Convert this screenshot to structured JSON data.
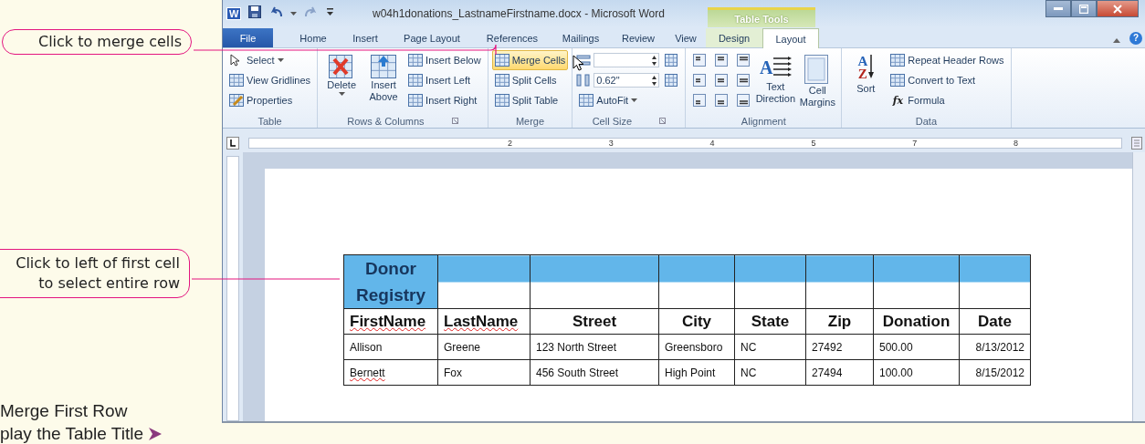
{
  "callouts": [
    {
      "text": "Click to merge cells"
    },
    {
      "text": "Click to left of first cell to select entire row"
    }
  ],
  "caption": {
    "line_1": "Merge First Row",
    "line_2": "play the Table Title"
  },
  "window": {
    "app_icon": "W",
    "title": "w04h1donations_LastnameFirstname.docx - Microsoft Word",
    "contextual_label": "Table Tools",
    "help": "?"
  },
  "tabs": [
    {
      "label": "File",
      "kind": "file",
      "selected": false
    },
    {
      "label": "Home",
      "kind": "plain",
      "selected": false
    },
    {
      "label": "Insert",
      "kind": "plain",
      "selected": false
    },
    {
      "label": "Page Layout",
      "kind": "plain",
      "selected": false
    },
    {
      "label": "References",
      "kind": "plain",
      "selected": false
    },
    {
      "label": "Mailings",
      "kind": "plain",
      "selected": false
    },
    {
      "label": "Review",
      "kind": "plain",
      "selected": false
    },
    {
      "label": "View",
      "kind": "plain",
      "selected": false
    },
    {
      "label": "Design",
      "kind": "context",
      "selected": false
    },
    {
      "label": "Layout",
      "kind": "context",
      "selected": true
    }
  ],
  "ribbon": [
    {
      "label": "Table",
      "launcher": false,
      "columns": [
        [
          {
            "kind": "small",
            "label": "Select",
            "dropdown": true,
            "highlighted": false
          },
          {
            "kind": "small",
            "label": "View Gridlines",
            "dropdown": false,
            "highlighted": false
          },
          {
            "kind": "small",
            "label": "Properties",
            "dropdown": false,
            "highlighted": false
          }
        ]
      ]
    },
    {
      "label": "Rows & Columns",
      "launcher": true,
      "columns": [
        [
          {
            "kind": "large",
            "label": "Delete",
            "dropdown": true,
            "highlighted": false
          }
        ],
        [
          {
            "kind": "large",
            "label": "Insert Above",
            "dropdown": false,
            "highlighted": false
          }
        ],
        [
          {
            "kind": "small",
            "label": "Insert Below",
            "dropdown": false,
            "highlighted": false
          },
          {
            "kind": "small",
            "label": "Insert Left",
            "dropdown": false,
            "highlighted": false
          },
          {
            "kind": "small",
            "label": "Insert Right",
            "dropdown": false,
            "highlighted": false
          }
        ]
      ]
    },
    {
      "label": "Merge",
      "launcher": false,
      "columns": [
        [
          {
            "kind": "small",
            "label": "Merge Cells",
            "dropdown": false,
            "highlighted": true
          },
          {
            "kind": "small",
            "label": "Split Cells",
            "dropdown": false,
            "highlighted": false
          },
          {
            "kind": "small",
            "label": "Split Table",
            "dropdown": false,
            "highlighted": false
          }
        ]
      ]
    },
    {
      "label": "Cell Size",
      "launcher": true,
      "columns": [
        [
          {
            "kind": "field",
            "highlighted": false
          },
          {
            "kind": "field",
            "value": "0.62\"",
            "highlighted": false
          },
          {
            "kind": "small",
            "label": "AutoFit",
            "dropdown": true,
            "highlighted": false
          }
        ],
        [
          {
            "kind": "icon",
            "highlighted": false
          },
          {
            "kind": "icon",
            "highlighted": false
          }
        ]
      ]
    },
    {
      "label": "Alignment",
      "launcher": false,
      "columns": [
        [
          {
            "kind": "align",
            "highlighted": false
          },
          {
            "kind": "align",
            "highlighted": false
          },
          {
            "kind": "align",
            "highlighted": false
          }
        ],
        [
          {
            "kind": "align",
            "highlighted": false
          },
          {
            "kind": "align",
            "highlighted": false
          },
          {
            "kind": "align",
            "highlighted": false
          }
        ],
        [
          {
            "kind": "align",
            "highlighted": false
          },
          {
            "kind": "align",
            "highlighted": false
          },
          {
            "kind": "align",
            "highlighted": false
          }
        ],
        [
          {
            "kind": "large",
            "label": "Text Direction",
            "symbol": "A",
            "dropdown": false,
            "highlighted": false
          }
        ],
        [
          {
            "kind": "large",
            "label": "Cell Margins",
            "dropdown": false,
            "highlighted": false
          }
        ]
      ]
    },
    {
      "label": "Data",
      "launcher": false,
      "columns": [
        [
          {
            "kind": "large",
            "label": "Sort",
            "symbol": "A",
            "symbol_2": "Z",
            "dropdown": false,
            "highlighted": false
          }
        ],
        [
          {
            "kind": "small",
            "label": "Repeat Header Rows",
            "dropdown": false,
            "highlighted": false
          },
          {
            "kind": "small",
            "label": "Convert to Text",
            "dropdown": false,
            "highlighted": false
          },
          {
            "kind": "small",
            "label": "Formula",
            "symbol": "fx",
            "dropdown": false,
            "highlighted": false
          }
        ]
      ]
    }
  ],
  "ruler": {
    "labels": [
      "2",
      "3",
      "4",
      "5",
      "7",
      "8"
    ]
  },
  "table": {
    "rows": [
      {
        "kind": "title",
        "selected": true,
        "cells": [
          {
            "text": "Donor Registry",
            "misspelled": false
          },
          {
            "misspelled": false
          },
          {
            "misspelled": false
          },
          {
            "misspelled": false
          },
          {
            "misspelled": false
          },
          {
            "misspelled": false
          },
          {
            "misspelled": false
          },
          {
            "misspelled": false
          }
        ]
      },
      {
        "kind": "header",
        "selected": false,
        "cells": [
          {
            "text": "FirstName",
            "misspelled": true
          },
          {
            "text": "LastName",
            "misspelled": true
          },
          {
            "text": "Street",
            "misspelled": false
          },
          {
            "text": "City",
            "misspelled": false
          },
          {
            "text": "State",
            "misspelled": false
          },
          {
            "text": "Zip",
            "misspelled": false
          },
          {
            "text": "Donation",
            "misspelled": false
          },
          {
            "text": "Date",
            "misspelled": false
          }
        ]
      },
      {
        "kind": "data",
        "selected": false,
        "cells": [
          {
            "text": "Allison",
            "misspelled": false
          },
          {
            "text": "Greene",
            "misspelled": false
          },
          {
            "text": "123 North Street",
            "misspelled": false
          },
          {
            "text": "Greensboro",
            "misspelled": false
          },
          {
            "text": "NC",
            "misspelled": false
          },
          {
            "text": "27492",
            "misspelled": false
          },
          {
            "text": "500.00",
            "misspelled": false
          },
          {
            "text": "8/13/2012",
            "misspelled": false
          }
        ]
      },
      {
        "kind": "data",
        "selected": false,
        "cells": [
          {
            "text": "Bernett",
            "misspelled": true
          },
          {
            "text": "Fox",
            "misspelled": false
          },
          {
            "text": "456 South Street",
            "misspelled": false
          },
          {
            "text": "High Point",
            "misspelled": false
          },
          {
            "text": "NC",
            "misspelled": false
          },
          {
            "text": "27494",
            "misspelled": false
          },
          {
            "text": "100.00",
            "misspelled": false
          },
          {
            "text": "8/15/2012",
            "misspelled": false
          }
        ]
      }
    ]
  }
}
